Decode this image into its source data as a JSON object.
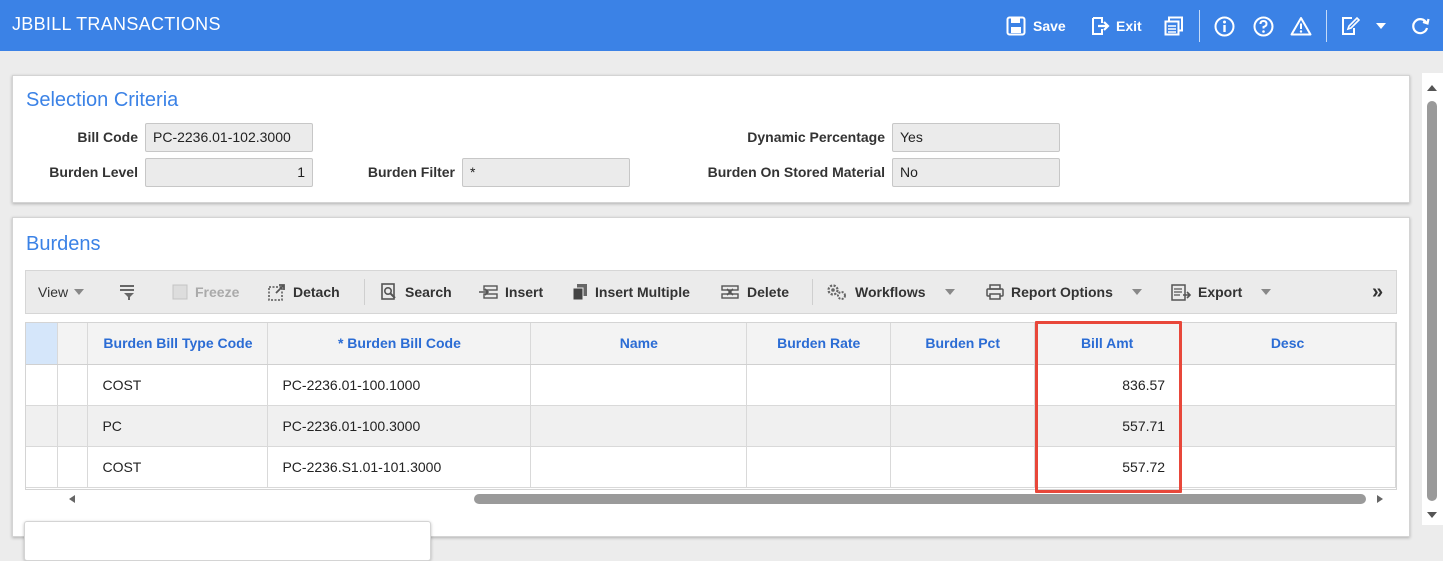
{
  "window": {
    "title": "JBBILL TRANSACTIONS"
  },
  "titlebar": {
    "save_label": "Save",
    "exit_label": "Exit"
  },
  "selection": {
    "title": "Selection Criteria",
    "bill_code_label": "Bill Code",
    "bill_code_value": "PC-2236.01-102.3000",
    "burden_level_label": "Burden Level",
    "burden_level_value": "1",
    "burden_filter_label": "Burden Filter",
    "burden_filter_value": "*",
    "dynamic_pct_label": "Dynamic Percentage",
    "dynamic_pct_value": "Yes",
    "burden_stored_label": "Burden On Stored Material",
    "burden_stored_value": "No"
  },
  "burdens": {
    "title": "Burdens",
    "toolbar": {
      "view": "View",
      "freeze": "Freeze",
      "detach": "Detach",
      "search": "Search",
      "insert": "Insert",
      "insert_multiple": "Insert Multiple",
      "delete": "Delete",
      "workflows": "Workflows",
      "report_options": "Report Options",
      "export": "Export",
      "more": "»"
    },
    "columns": [
      "Burden Bill Type Code",
      "* Burden Bill Code",
      "Name",
      "Burden Rate",
      "Burden Pct",
      "Bill Amt",
      "Desc"
    ],
    "rows": [
      {
        "type_code": "COST",
        "bill_code": "PC-2236.01-100.1000",
        "name": "",
        "rate": "",
        "pct": "",
        "amt": "836.57",
        "desc": ""
      },
      {
        "type_code": "PC",
        "bill_code": "PC-2236.01-100.3000",
        "name": "",
        "rate": "",
        "pct": "",
        "amt": "557.71",
        "desc": ""
      },
      {
        "type_code": "COST",
        "bill_code": "PC-2236.S1.01-101.3000",
        "name": "",
        "rate": "",
        "pct": "",
        "amt": "557.72",
        "desc": ""
      }
    ]
  },
  "colors": {
    "accent": "#3b82e6",
    "header_text": "#2b6cd4",
    "highlight": "#e8473a"
  }
}
